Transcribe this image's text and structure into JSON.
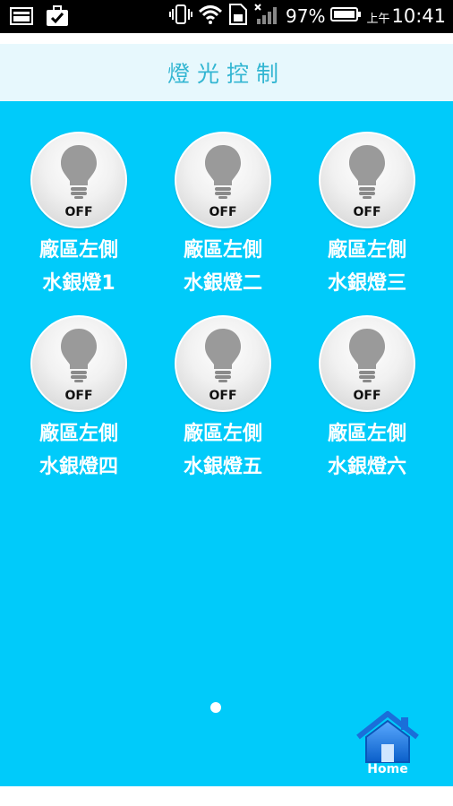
{
  "status_bar": {
    "battery_percent": "97%",
    "ampm": "上午",
    "time": "10:41",
    "icons": [
      "image-icon",
      "briefcase-icon",
      "vibrate-icon",
      "wifi-icon",
      "sim-icon",
      "signal-icon",
      "battery-icon"
    ]
  },
  "header": {
    "title": "燈光控制"
  },
  "lights": [
    {
      "line1": "廠區左側",
      "line2": "水銀燈1",
      "state": "OFF"
    },
    {
      "line1": "廠區左側",
      "line2": "水銀燈二",
      "state": "OFF"
    },
    {
      "line1": "廠區左側",
      "line2": "水銀燈三",
      "state": "OFF"
    },
    {
      "line1": "廠區左側",
      "line2": "水銀燈四",
      "state": "OFF"
    },
    {
      "line1": "廠區左側",
      "line2": "水銀燈五",
      "state": "OFF"
    },
    {
      "line1": "廠區左側",
      "line2": "水銀燈六",
      "state": "OFF"
    }
  ],
  "page_indicator": {
    "pages": 1,
    "current": 1
  },
  "home_button": {
    "label": "Home"
  },
  "colors": {
    "main_bg": "#00cbfa",
    "title_bar_bg": "#e7f8fd",
    "title_text": "#33b6d2",
    "label_text": "#ffffff"
  }
}
